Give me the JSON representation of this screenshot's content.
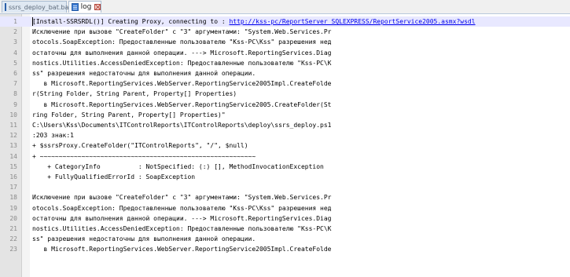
{
  "tabs": [
    {
      "label": "ssrs_deploy_bat.bat",
      "active": false,
      "icon": "file-icon"
    },
    {
      "label": "log",
      "active": true,
      "icon": "file-icon"
    }
  ],
  "editor": {
    "lines": [
      {
        "n": "1",
        "pre": "[Install-SSRSRDL()] Creating Proxy, connecting to : ",
        "url": "http://kss-pc/ReportServer_SQLEXPRESS/ReportService2005.asmx?wsdl",
        "post": "",
        "current": true
      },
      {
        "n": "2",
        "pre": "Исключение при вызове \"CreateFolder\" с \"3\" аргументами: \"System.Web.Services.Pr"
      },
      {
        "n": "3",
        "pre": "otocols.SoapException: Предоставленные пользователю \"Kss-PC\\Kss\" разрешения нед"
      },
      {
        "n": "4",
        "pre": "остаточны для выполнения данной операции. ---> Microsoft.ReportingServices.Diag"
      },
      {
        "n": "5",
        "pre": "nostics.Utilities.AccessDeniedException: Предоставленные пользователю \"Kss-PC\\K"
      },
      {
        "n": "6",
        "pre": "ss\" разрешения недостаточны для выполнения данной операции."
      },
      {
        "n": "7",
        "pre": "   в Microsoft.ReportingServices.WebServer.ReportingService2005Impl.CreateFolde"
      },
      {
        "n": "8",
        "pre": "r(String Folder, String Parent, Property[] Properties)"
      },
      {
        "n": "9",
        "pre": "   в Microsoft.ReportingServices.WebServer.ReportingService2005.CreateFolder(St"
      },
      {
        "n": "10",
        "pre": "ring Folder, String Parent, Property[] Properties)\""
      },
      {
        "n": "11",
        "pre": "C:\\Users\\Kss\\Documents\\ITControlReports\\ITControlReports\\deploy\\ssrs_deploy.ps1"
      },
      {
        "n": "12",
        "pre": ":203 знак:1"
      },
      {
        "n": "13",
        "pre": "+ $ssrsProxy.CreateFolder(\"ITControlReports\", \"/\", $null)"
      },
      {
        "n": "14",
        "pre": "+ ~~~~~~~~~~~~~~~~~~~~~~~~~~~~~~~~~~~~~~~~~~~~~~~~~~~~~~~~~"
      },
      {
        "n": "15",
        "pre": "    + CategoryInfo          : NotSpecified: (:) [], MethodInvocationException"
      },
      {
        "n": "16",
        "pre": "    + FullyQualifiedErrorId : SoapException"
      },
      {
        "n": "17",
        "pre": ""
      },
      {
        "n": "18",
        "pre": "Исключение при вызове \"CreateFolder\" с \"3\" аргументами: \"System.Web.Services.Pr"
      },
      {
        "n": "19",
        "pre": "otocols.SoapException: Предоставленные пользователю \"Kss-PC\\Kss\" разрешения нед"
      },
      {
        "n": "20",
        "pre": "остаточны для выполнения данной операции. ---> Microsoft.ReportingServices.Diag"
      },
      {
        "n": "21",
        "pre": "nostics.Utilities.AccessDeniedException: Предоставленные пользователю \"Kss-PC\\K"
      },
      {
        "n": "22",
        "pre": "ss\" разрешения недостаточны для выполнения данной операции."
      },
      {
        "n": "23",
        "pre": "   в Microsoft.ReportingServices.WebServer.ReportingService2005Impl.CreateFolde"
      }
    ]
  }
}
